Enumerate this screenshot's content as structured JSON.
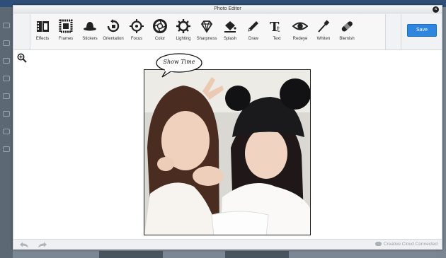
{
  "window": {
    "title": "Photo Editor",
    "close_glyph": "×"
  },
  "toolbar": {
    "tools": [
      {
        "label": "Effects",
        "icon": "film-strip-icon"
      },
      {
        "label": "Frames",
        "icon": "frame-icon"
      },
      {
        "label": "Stickers",
        "icon": "bowler-hat-icon"
      },
      {
        "label": "Orientation",
        "icon": "rotate-icon"
      },
      {
        "label": "Focus",
        "icon": "crosshair-icon"
      },
      {
        "label": "Color",
        "icon": "aperture-icon"
      },
      {
        "label": "Lighting",
        "icon": "sun-gear-icon"
      },
      {
        "label": "Sharpness",
        "icon": "diamond-icon"
      },
      {
        "label": "Splash",
        "icon": "paint-bucket-icon"
      },
      {
        "label": "Draw",
        "icon": "pencil-icon"
      },
      {
        "label": "Text",
        "icon": "text-icon"
      },
      {
        "label": "Redeye",
        "icon": "eye-icon"
      },
      {
        "label": "Whiten",
        "icon": "brush-icon"
      },
      {
        "label": "Blemish",
        "icon": "bandage-icon"
      }
    ],
    "save_label": "Save",
    "accent_color": "#2e86de"
  },
  "canvas": {
    "sticker_text": "Show Time"
  },
  "footer": {
    "status": "Creative Cloud Connected"
  }
}
